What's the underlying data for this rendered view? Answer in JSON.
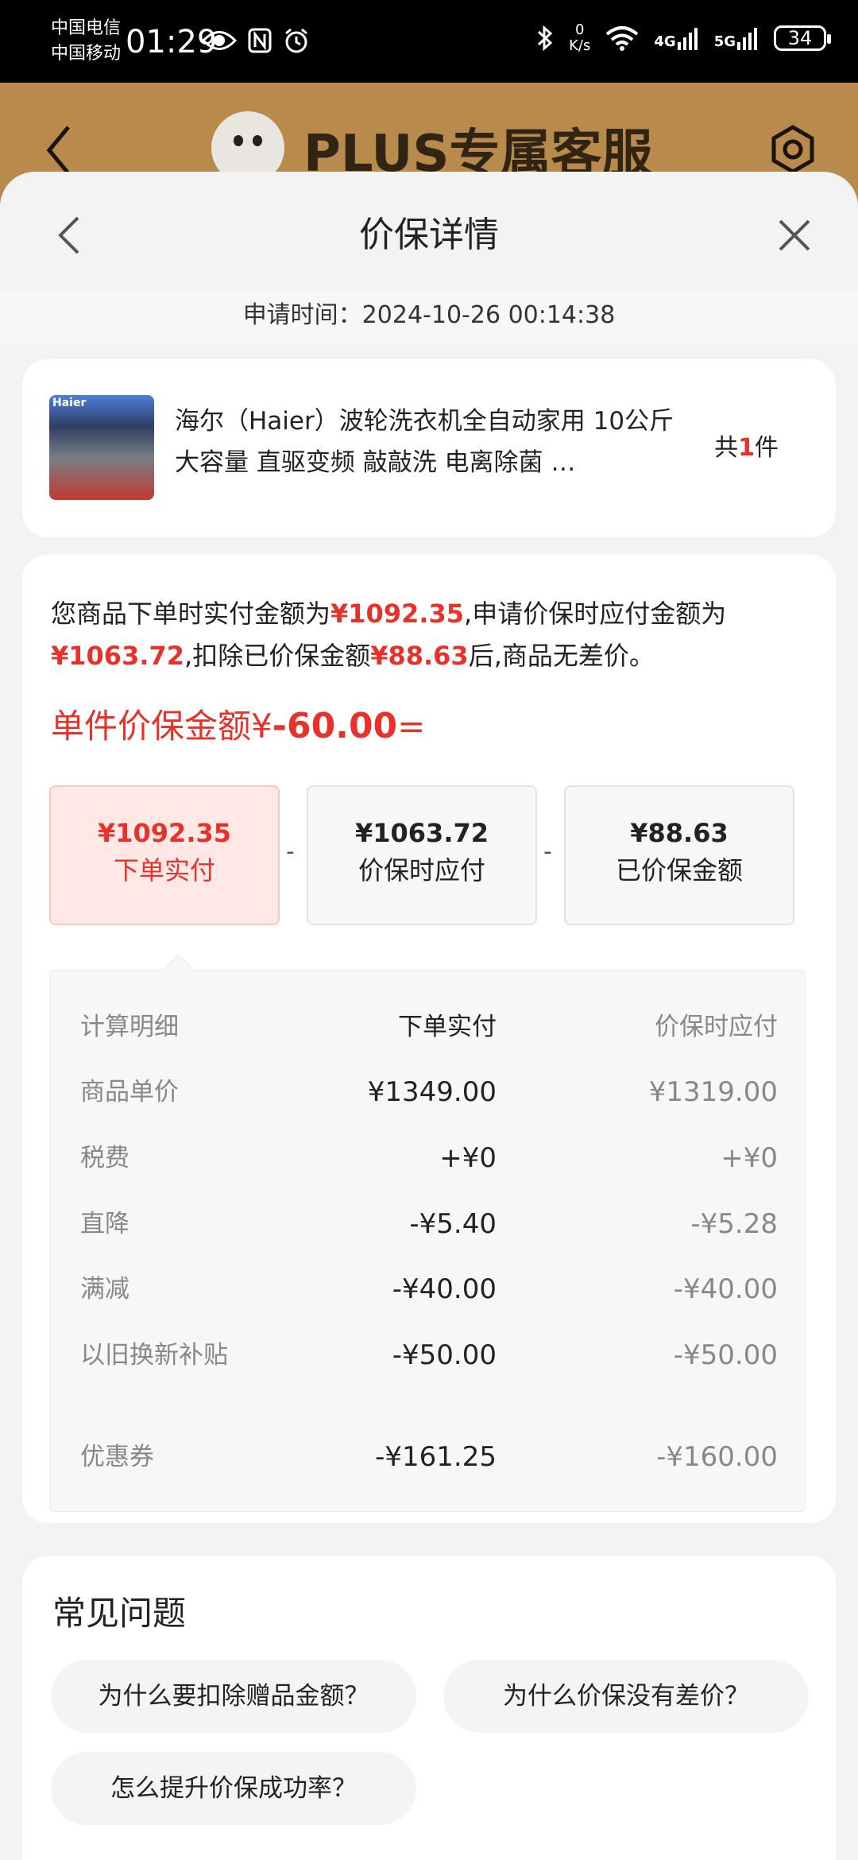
{
  "status_bar": {
    "carrier_1": "中国电信",
    "carrier_2": "中国移动",
    "time": "01:29",
    "net_speed_value": "0",
    "net_speed_unit": "K/s",
    "signal_1": "4G",
    "signal_2": "5G",
    "battery": "34"
  },
  "background_page": {
    "title": "PLUS专属客服"
  },
  "sheet": {
    "title": "价保详情",
    "apply_time": "申请时间：2024-10-26 00:14:38"
  },
  "product": {
    "brand_label": "Haier",
    "name": "海尔（Haier）波轮洗衣机全自动家用 10公斤大容量 直驱变频 敲敲洗 电离除菌 …",
    "qty_prefix": "共",
    "qty": "1",
    "qty_suffix": "件"
  },
  "summary": {
    "t1": "您商品下单时实付金额为",
    "paid": "¥1092.35",
    "t2": ",申请价保时应付金额为",
    "should_pay": "¥1063.72",
    "t3": ",扣除已价保金额",
    "protected": "¥88.63",
    "t4": "后,商品无差价。"
  },
  "per_unit": {
    "label": "单件价保金额¥",
    "value": "-60.00",
    "suffix": "="
  },
  "boxes": [
    {
      "amount": "¥1092.35",
      "label": "下单实付"
    },
    {
      "amount": "¥1063.72",
      "label": "价保时应付"
    },
    {
      "amount": "¥88.63",
      "label": "已价保金额"
    }
  ],
  "operators": [
    "-",
    "-"
  ],
  "breakdown": {
    "headers": [
      "计算明细",
      "下单实付",
      "价保时应付"
    ],
    "rows": [
      {
        "name": "商品单价",
        "paid": "¥1349.00",
        "now": "¥1319.00"
      },
      {
        "name": "税费",
        "paid": "+¥0",
        "now": "+¥0"
      },
      {
        "name": "直降",
        "paid": "-¥5.40",
        "now": "-¥5.28"
      },
      {
        "name": "满减",
        "paid": "-¥40.00",
        "now": "-¥40.00"
      },
      {
        "name": "以旧换新补贴",
        "paid": "-¥50.00",
        "now": "-¥50.00"
      },
      {
        "name": "优惠券",
        "paid": "-¥161.25",
        "now": "-¥160.00"
      }
    ]
  },
  "faq": {
    "title": "常见问题",
    "items": [
      "为什么要扣除赠品金额？",
      "为什么价保没有差价？",
      "怎么提升价保成功率？"
    ]
  },
  "colors": {
    "accent_red": "#e8312a",
    "active_box_bg": "#ffe8e6"
  }
}
